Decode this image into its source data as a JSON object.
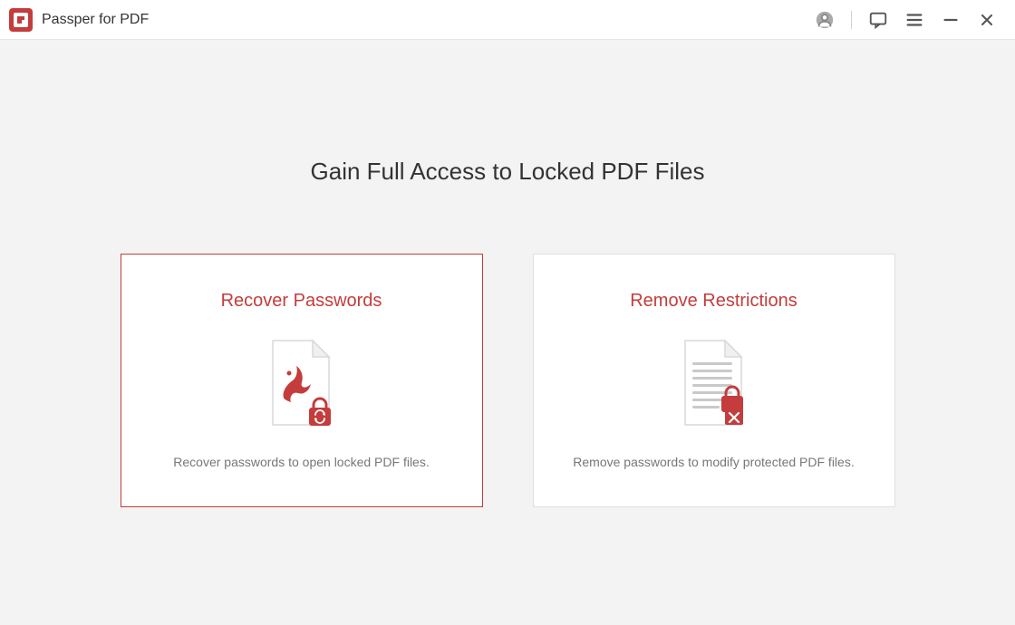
{
  "app": {
    "title": "Passper for PDF"
  },
  "main": {
    "heading": "Gain Full Access to Locked PDF Files"
  },
  "cards": {
    "recover": {
      "title": "Recover Passwords",
      "description": "Recover passwords to open locked PDF files."
    },
    "remove": {
      "title": "Remove Restrictions",
      "description": "Remove passwords to modify protected PDF files."
    }
  },
  "colors": {
    "accent": "#c43c3c",
    "text_primary": "#333333",
    "text_muted": "#777777"
  }
}
